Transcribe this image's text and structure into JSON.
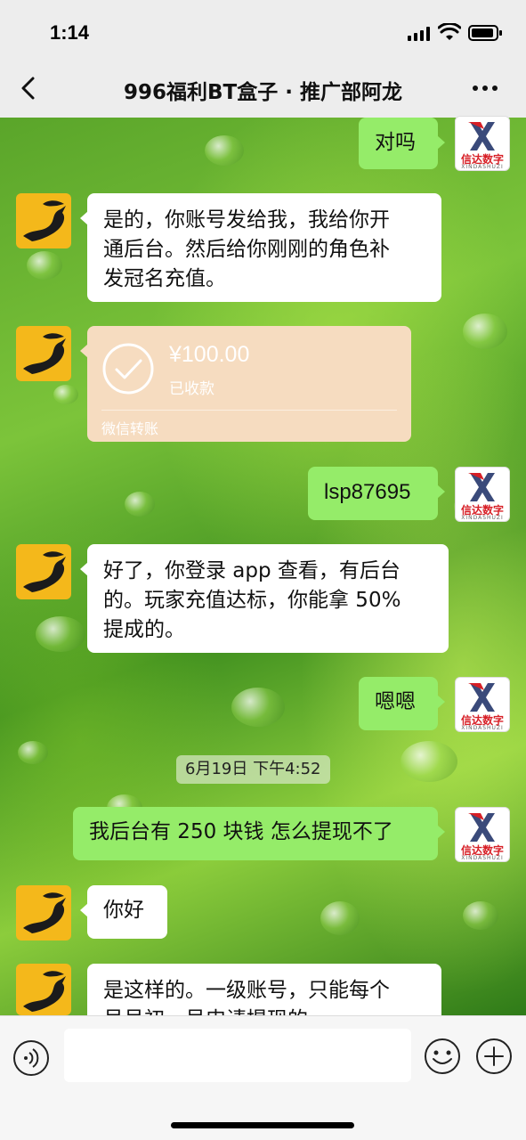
{
  "status": {
    "time": "1:14"
  },
  "nav": {
    "title": "996福利BT盒子 · 推广部阿龙"
  },
  "contact_logo": {
    "name_cn": "信达数字",
    "name_en": "XINDASHUZI"
  },
  "messages": [
    {
      "side": "out",
      "text": "对吗"
    },
    {
      "side": "in",
      "lines": [
        "是的，你账号发给我，我给你开",
        "通后台。然后给你刚刚的角色补",
        "发冠名充值。"
      ]
    },
    {
      "side": "in",
      "type": "transfer",
      "amount": "¥100.00",
      "status": "已收款",
      "label": "微信转账"
    },
    {
      "side": "out",
      "text": "lsp87695"
    },
    {
      "side": "in",
      "lines": [
        "好了，你登录 app 查看，有后台",
        "的。玩家充值达标，你能拿 50%",
        "提成的。"
      ]
    },
    {
      "side": "out",
      "text": "嗯嗯"
    },
    {
      "type": "timestamp",
      "text": "6月19日 下午4:52"
    },
    {
      "side": "out",
      "text": "我后台有 250 块钱 怎么提现不了"
    },
    {
      "side": "in",
      "text": "你好"
    },
    {
      "side": "in",
      "lines": [
        "是这样的。一级账号，只能每个",
        "号号初，号申请提现的"
      ]
    }
  ],
  "input": {
    "placeholder": ""
  }
}
